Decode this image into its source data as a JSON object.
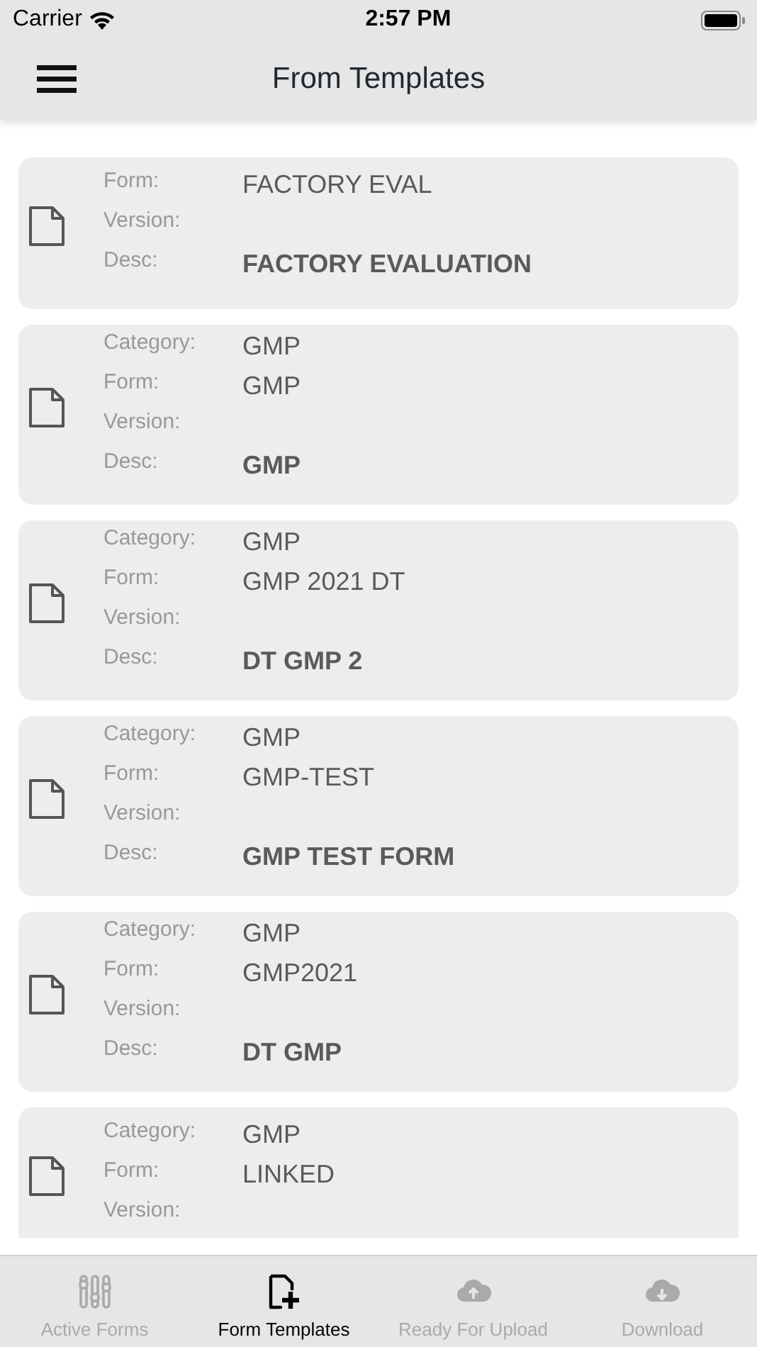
{
  "status_bar": {
    "carrier": "Carrier",
    "time": "2:57 PM"
  },
  "nav_bar": {
    "title": "From Templates"
  },
  "templates": [
    {
      "fields": [
        {
          "label": "Form:",
          "value": "FACTORY EVAL",
          "emphasis": false
        },
        {
          "label": "Version:"
        },
        {
          "label": "Desc:",
          "value": "FACTORY EVALUATION",
          "emphasis": true
        }
      ]
    },
    {
      "fields": [
        {
          "label": "Category:",
          "value": "GMP",
          "emphasis": false
        },
        {
          "label": "Form:",
          "value": "GMP",
          "emphasis": false
        },
        {
          "label": "Version:"
        },
        {
          "label": "Desc:",
          "value": "GMP",
          "emphasis": true
        }
      ]
    },
    {
      "fields": [
        {
          "label": "Category:",
          "value": "GMP",
          "emphasis": false
        },
        {
          "label": "Form:",
          "value": "GMP 2021 DT",
          "emphasis": false
        },
        {
          "label": "Version:"
        },
        {
          "label": "Desc:",
          "value": "DT GMP 2",
          "emphasis": true
        }
      ]
    },
    {
      "fields": [
        {
          "label": "Category:",
          "value": "GMP",
          "emphasis": false
        },
        {
          "label": "Form:",
          "value": "GMP-TEST",
          "emphasis": false
        },
        {
          "label": "Version:"
        },
        {
          "label": "Desc:",
          "value": "GMP TEST FORM",
          "emphasis": true
        }
      ]
    },
    {
      "fields": [
        {
          "label": "Category:",
          "value": "GMP",
          "emphasis": false
        },
        {
          "label": "Form:",
          "value": "GMP2021",
          "emphasis": false
        },
        {
          "label": "Version:"
        },
        {
          "label": "Desc:",
          "value": "DT GMP",
          "emphasis": true
        }
      ]
    },
    {
      "fields": [
        {
          "label": "Category:",
          "value": "GMP",
          "emphasis": false
        },
        {
          "label": "Form:",
          "value": "LINKED",
          "emphasis": false
        },
        {
          "label": "Version:"
        }
      ]
    }
  ],
  "tab_bar": [
    {
      "kind": "sliders",
      "label": "Active Forms",
      "selected": false
    },
    {
      "kind": "file-plus",
      "label": "Form Templates",
      "selected": true
    },
    {
      "kind": "upload",
      "label": "Ready For Upload",
      "selected": false
    },
    {
      "kind": "download",
      "label": "Download",
      "selected": false
    }
  ]
}
